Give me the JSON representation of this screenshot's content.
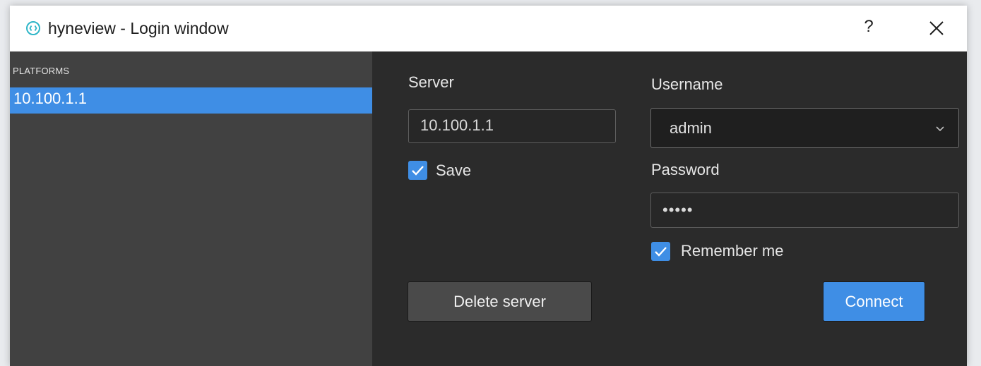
{
  "window": {
    "title": "hyneview - Login window",
    "help_label": "?",
    "app_icon": "hyneview-logo-icon",
    "close_icon": "close-icon"
  },
  "sidebar": {
    "header": "PLATFORMS",
    "items": [
      {
        "label": "10.100.1.1",
        "selected": true
      }
    ]
  },
  "form": {
    "server_label": "Server",
    "server_value": "10.100.1.1",
    "save_label": "Save",
    "save_checked": true,
    "username_label": "Username",
    "username_value": "admin",
    "password_label": "Password",
    "password_value": "•••••",
    "remember_label": "Remember me",
    "remember_checked": true,
    "delete_button": "Delete server",
    "connect_button": "Connect"
  },
  "colors": {
    "accent": "#3f8ee5",
    "sidebar_bg": "#414141",
    "main_bg": "#2b2b2b",
    "titlebar_bg": "#ffffff"
  }
}
